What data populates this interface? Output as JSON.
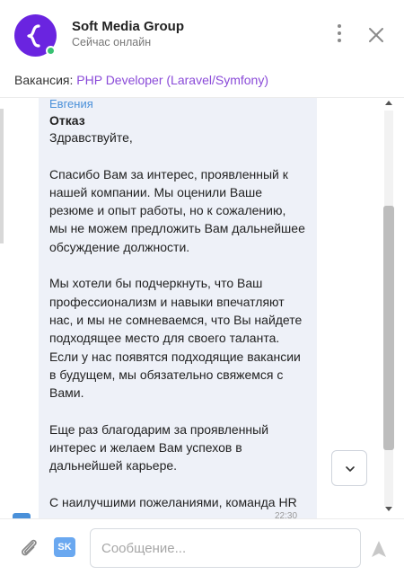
{
  "header": {
    "company": "Soft Media Group",
    "status": "Сейчас онлайн",
    "brand_color": "#6a24e0",
    "online_color": "#38c172"
  },
  "vacancy": {
    "label": "Вакансия:",
    "title": "PHP Developer (Laravel/Symfony)"
  },
  "message": {
    "sender": "Евгения",
    "subject": "Отказ",
    "paragraphs": [
      "Здравствуйте,",
      "Спасибо Вам за интерес, проявленный к нашей компании. Мы оценили Ваше резюме и опыт работы, но к сожалению, мы не можем предложить Вам дальнейшее обсуждение должности.",
      "Мы хотели бы подчеркнуть, что Ваш профессионализм и навыки впечатляют нас, и мы не сомневаемся, что Вы найдете подходящее место для своего таланта. Если у нас появятся подходящие вакансии в будущем, мы обязательно свяжемся с Вами.",
      "Еще раз благодарим за проявленный интерес и желаем Вам успехов в дальнейшей карьере.",
      "С наилучшими пожеланиями, команда HR"
    ],
    "time": "22:30"
  },
  "composer": {
    "placeholder": "Сообщение...",
    "sk_label": "SK"
  },
  "icons": {
    "avatar_logo": "curly-brace-logo",
    "menu": "kebab-menu-icon",
    "close": "close-icon",
    "scroll_down": "chevron-down-icon",
    "attach": "paperclip-icon",
    "send": "send-arrow-icon"
  }
}
